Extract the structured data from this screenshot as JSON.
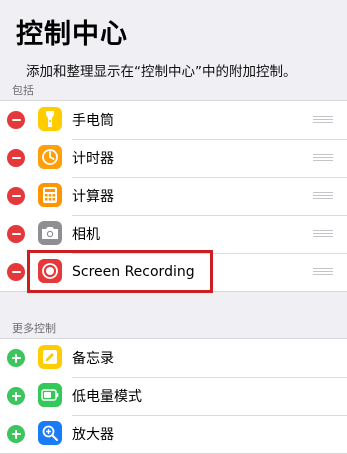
{
  "page": {
    "title": "控制中心",
    "description": "添加和整理显示在“控制中心”中的附加控制。"
  },
  "included": {
    "header": "包括",
    "items": [
      {
        "label": "手电筒",
        "icon": "flashlight-icon",
        "color": "#ffcc00"
      },
      {
        "label": "计时器",
        "icon": "timer-icon",
        "color": "#ff9f0a"
      },
      {
        "label": "计算器",
        "icon": "calculator-icon",
        "color": "#ff9500"
      },
      {
        "label": "相机",
        "icon": "camera-icon",
        "color": "#8e8e93"
      },
      {
        "label": "Screen Recording",
        "icon": "screen-recording-icon",
        "color": "#e5383b"
      }
    ]
  },
  "more": {
    "header": "更多控制",
    "items": [
      {
        "label": "备忘录",
        "icon": "notes-icon",
        "color": "#ffcc00"
      },
      {
        "label": "低电量模式",
        "icon": "low-power-mode-icon",
        "color": "#34c759"
      },
      {
        "label": "放大器",
        "icon": "magnifier-icon",
        "color": "#1a7cf5"
      }
    ]
  },
  "colors": {
    "remove": "#e5383b",
    "add": "#3cc55c",
    "highlight": "#cc1f1f",
    "background": "#efeff4"
  }
}
